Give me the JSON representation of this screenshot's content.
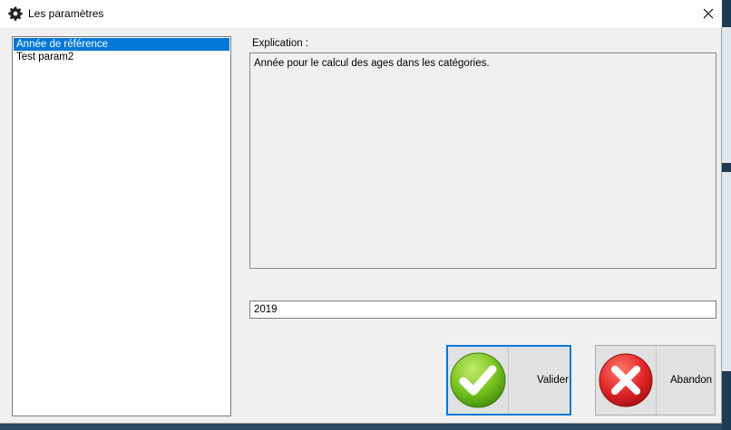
{
  "window": {
    "title": "Les paramètres"
  },
  "icons": {
    "title": "gear-icon",
    "close": "close-icon",
    "valider": "green-check-icon",
    "abandon": "red-x-icon"
  },
  "param_list": {
    "items": [
      {
        "label": "Année de référence",
        "selected": true
      },
      {
        "label": "Test param2",
        "selected": false
      }
    ]
  },
  "explication": {
    "label": "Explication :",
    "text": "Année pour le calcul des ages dans les catégories."
  },
  "value_field": {
    "value": "2019"
  },
  "buttons": {
    "valider": "Valider",
    "abandon": "Abandon"
  },
  "colors": {
    "selection": "#0078d7",
    "ok_green": "#6fbf20",
    "cancel_red": "#e0282a"
  }
}
